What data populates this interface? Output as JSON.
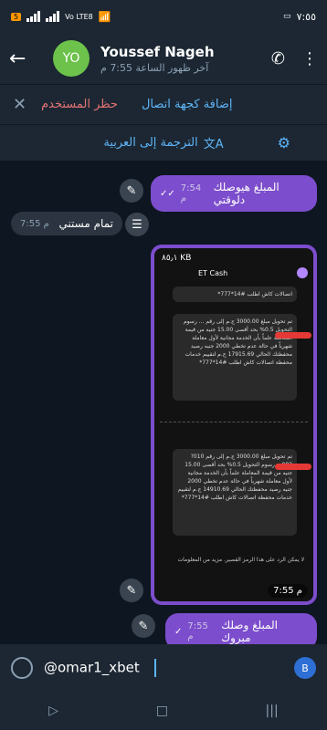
{
  "status_bar": {
    "time": "٧:٥٥",
    "sim_badge": "5",
    "network": "Vo LTE8",
    "wifi_icon": "wifi-icon",
    "battery_icon": "battery-icon"
  },
  "header": {
    "back_icon": "arrow-left-icon",
    "avatar_initials": "YO",
    "name": "Youssef Nageh",
    "last_seen": "آخر ظهور الساعة 7:55 م",
    "call_icon": "phone-icon",
    "menu_icon": "more-vertical-icon",
    "avatar_color": "#6cc24a"
  },
  "action_bar": {
    "close_label": "✕",
    "block_label": "حظر المستخدم",
    "add_contact_label": "إضافة كجهة اتصال"
  },
  "translate_bar": {
    "label": "الترجمة إلى العربية",
    "translate_icon": "translate-icon",
    "filter_icon": "sliders-icon"
  },
  "messages": [
    {
      "text": "المبلغ هيوصلك دلوقتي",
      "time": "7:54 م",
      "outgoing": true
    },
    {
      "text": "تمام مستني",
      "time": "7:55 م",
      "outgoing": false
    },
    {
      "text": "المبلغ وصلك مبروك",
      "time": "7:55 م",
      "outgoing": true
    }
  ],
  "photo": {
    "time": "7:55 م",
    "size_label": "٨٥٫١ KB",
    "app_title": "ET Cash",
    "msg1_top": "اتصالات كاش اطلب #14*777*",
    "msg1": "تم تحويل مبلغ 3000.00 ج.م إلى رقم ... رسوم التحويل 0.5% بحد أقصى 15.00 جنيه من قيمة المعاملة علماً بأن الخدمة مجانية لأول معاملة شهرياً في حالة عدم تخطي 2000 جنيه رصيد محفظتك الحالي 17915.69 ج.م لتقييم خدمات محفظة اتصالات كاش اطلب #14*777*",
    "msg2": "تم تحويل مبلغ 3000.00 ج.م إلى رقم 010?083... رسوم التحويل 0.5% بحد أقصى 15.00 جنيه من قيمة المعاملة علماً بأن الخدمة مجانية لأول معاملة شهرياً في حالة عدم تخطي 2000 جنيه رصيد محفظتك الحالي 14910.69 ج.م لتقييم خدمات محفظة اتصالات كاش اطلب #14*777*",
    "note": "لا يمكن الرد على هذا الرمز القصير. مزيد من المعلومات"
  },
  "input": {
    "value": "@omar1_xbet",
    "emoji_icon": "emoji-icon",
    "bot_icon": "bot-icon"
  },
  "nav": {
    "back_icon": "nav-back-icon",
    "home_icon": "nav-home-icon",
    "menu_icon": "nav-menu-icon"
  }
}
